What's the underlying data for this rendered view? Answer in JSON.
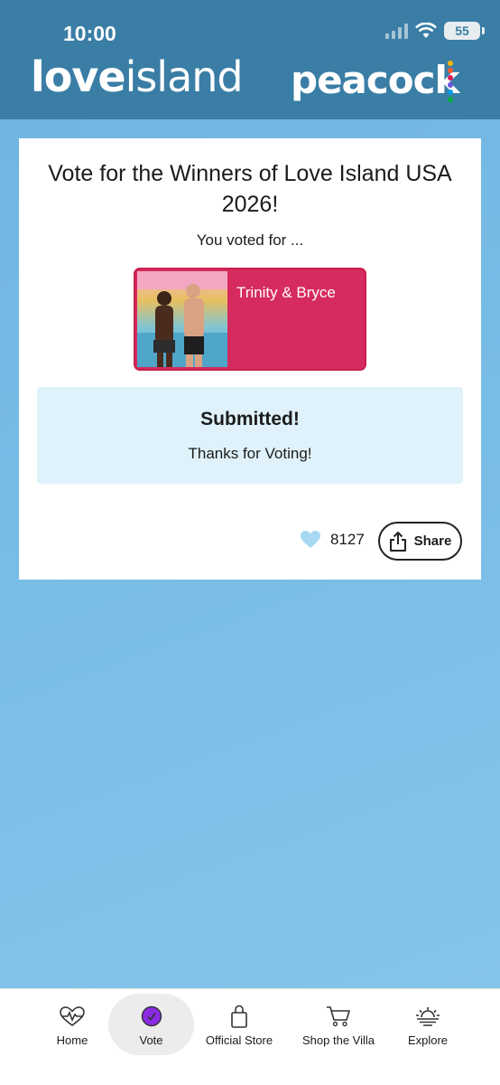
{
  "status_bar": {
    "time": "10:00",
    "battery": "55"
  },
  "header": {
    "left_logo_bold": "love",
    "left_logo_light": "island",
    "right_logo": "peacock"
  },
  "card": {
    "title": "Vote for the Winners of Love Island USA 2026!",
    "voted_label": "You voted for ...",
    "choice_name": "Trinity & Bryce",
    "submitted_title": "Submitted!",
    "submitted_sub": "Thanks for Voting!",
    "likes": "8127",
    "share_label": "Share"
  },
  "tabs": [
    {
      "label": "Home",
      "icon": "heartbeat-icon"
    },
    {
      "label": "Vote",
      "icon": "vote-check-icon",
      "active": true
    },
    {
      "label": "Official Store",
      "icon": "shopping-bag-icon"
    },
    {
      "label": "Shop the Villa",
      "icon": "cart-icon"
    },
    {
      "label": "Explore",
      "icon": "sunset-icon"
    }
  ],
  "colors": {
    "header_bg": "#3a7ea6",
    "choice_bg": "#d62b5e",
    "submitted_bg": "#dff2fb",
    "heart": "#a9d8f2",
    "vote_active": "#8a2be2"
  }
}
